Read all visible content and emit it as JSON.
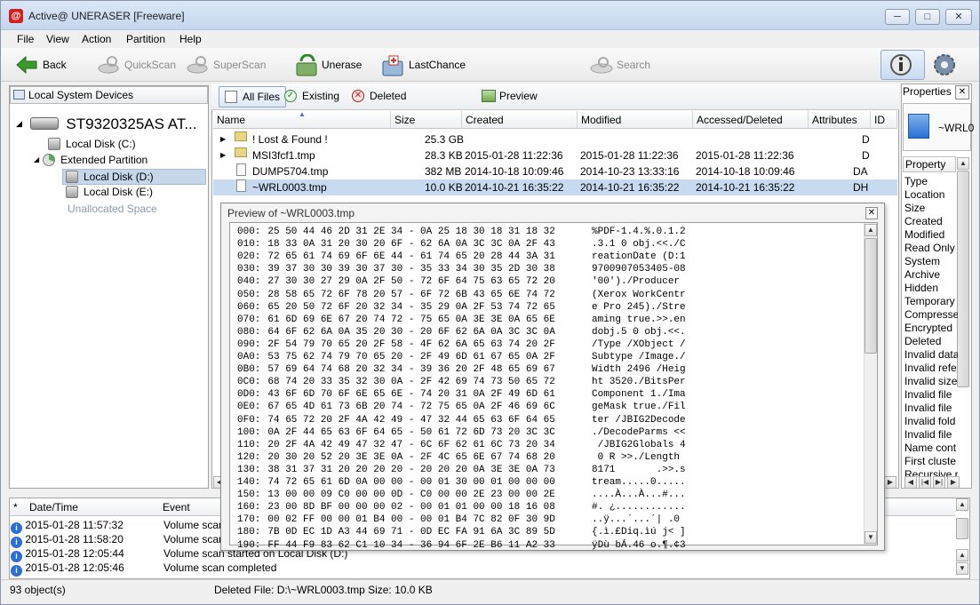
{
  "window": {
    "title": "Active@ UNERASER [Freeware]",
    "minimize": "─",
    "maximize": "□",
    "close": "✕"
  },
  "menu": [
    "File",
    "View",
    "Action",
    "Partition",
    "Help"
  ],
  "toolbar": {
    "back": "Back",
    "quickscan": "QuickScan",
    "superscan": "SuperScan",
    "unerase": "Unerase",
    "lastchance": "LastChance",
    "search": "Search"
  },
  "left_panel": {
    "title": "Local System Devices",
    "drive": "ST9320325AS AT...",
    "items": [
      "Local Disk (C:)",
      "Extended Partition",
      "Local Disk (D:)",
      "Local Disk (E:)",
      "Unallocated Space"
    ]
  },
  "file_tabs": {
    "all": "All Files",
    "existing": "Existing",
    "deleted": "Deleted",
    "preview": "Preview"
  },
  "columns": [
    "Name",
    "Size",
    "Created",
    "Modified",
    "Accessed/Deleted",
    "Attributes",
    "ID"
  ],
  "files": [
    {
      "name": "! Lost & Found !",
      "size": "25.3 GB",
      "created": "",
      "modified": "",
      "accessed": "",
      "attrs": "D"
    },
    {
      "name": "MSI3fcf1.tmp",
      "size": "28.3 KB",
      "created": "2015-01-28 11:22:36",
      "modified": "2015-01-28 11:22:36",
      "accessed": "2015-01-28 11:22:36",
      "attrs": "D"
    },
    {
      "name": "DUMP5704.tmp",
      "size": "382 MB",
      "created": "2014-10-18 10:09:46",
      "modified": "2014-10-23 13:33:16",
      "accessed": "2014-10-18 10:09:46",
      "attrs": "DA"
    },
    {
      "name": "~WRL0003.tmp",
      "size": "10.0 KB",
      "created": "2014-10-21 16:35:22",
      "modified": "2014-10-21 16:35:22",
      "accessed": "2014-10-21 16:35:22",
      "attrs": "DH"
    }
  ],
  "properties": {
    "title": "Properties",
    "file_name": "~WRL0",
    "header": "Property",
    "items": [
      "Type",
      "Location",
      "Size",
      "Created",
      "Modified",
      "Read Only",
      "System",
      "Archive",
      "Hidden",
      "Temporary",
      "Compressed",
      "Encrypted",
      "Deleted",
      "Invalid data",
      "Invalid refe",
      "Invalid size",
      "Invalid file",
      "Invalid file",
      "Invalid fold",
      "Invalid file",
      "Name cont",
      "First cluste",
      "Recursive r"
    ]
  },
  "preview": {
    "title": "Preview of ~WRL0003.tmp",
    "close": "✕",
    "rows": [
      {
        "off": "000:",
        "hex": "25 50 44 46 2D 31 2E 34 - 0A 25 18 30 18 31 18 32",
        "ascii": "%PDF-1.4.%.0.1.2"
      },
      {
        "off": "010:",
        "hex": "18 33 0A 31 20 30 20 6F - 62 6A 0A 3C 3C 0A 2F 43",
        "ascii": ".3.1 0 obj.<<./C"
      },
      {
        "off": "020:",
        "hex": "72 65 61 74 69 6F 6E 44 - 61 74 65 20 28 44 3A 31",
        "ascii": "reationDate (D:1"
      },
      {
        "off": "030:",
        "hex": "39 37 30 30 39 30 37 30 - 35 33 34 30 35 2D 30 38",
        "ascii": "9700907053405-08"
      },
      {
        "off": "040:",
        "hex": "27 30 30 27 29 0A 2F 50 - 72 6F 64 75 63 65 72 20",
        "ascii": "'00')./Producer "
      },
      {
        "off": "050:",
        "hex": "28 58 65 72 6F 78 20 57 - 6F 72 6B 43 65 6E 74 72",
        "ascii": "(Xerox WorkCentr"
      },
      {
        "off": "060:",
        "hex": "65 20 50 72 6F 20 32 34 - 35 29 0A 2F 53 74 72 65",
        "ascii": "e Pro 245)./Stre"
      },
      {
        "off": "070:",
        "hex": "61 6D 69 6E 67 20 74 72 - 75 65 0A 3E 3E 0A 65 6E",
        "ascii": "aming true.>>.en"
      },
      {
        "off": "080:",
        "hex": "64 6F 62 6A 0A 35 20 30 - 20 6F 62 6A 0A 3C 3C 0A",
        "ascii": "dobj.5 0 obj.<<."
      },
      {
        "off": "090:",
        "hex": "2F 54 79 70 65 20 2F 58 - 4F 62 6A 65 63 74 20 2F",
        "ascii": "/Type /XObject /"
      },
      {
        "off": "0A0:",
        "hex": "53 75 62 74 79 70 65 20 - 2F 49 6D 61 67 65 0A 2F",
        "ascii": "Subtype /Image./"
      },
      {
        "off": "0B0:",
        "hex": "57 69 64 74 68 20 32 34 - 39 36 20 2F 48 65 69 67",
        "ascii": "Width 2496 /Heig"
      },
      {
        "off": "0C0:",
        "hex": "68 74 20 33 35 32 30 0A - 2F 42 69 74 73 50 65 72",
        "ascii": "ht 3520./BitsPer"
      },
      {
        "off": "0D0:",
        "hex": "43 6F 6D 70 6F 6E 65 6E - 74 20 31 0A 2F 49 6D 61",
        "ascii": "Component 1./Ima"
      },
      {
        "off": "0E0:",
        "hex": "67 65 4D 61 73 6B 20 74 - 72 75 65 0A 2F 46 69 6C",
        "ascii": "geMask true./Fil"
      },
      {
        "off": "0F0:",
        "hex": "74 65 72 20 2F 4A 42 49 - 47 32 44 65 63 6F 64 65",
        "ascii": "ter /JBIG2Decode"
      },
      {
        "off": "100:",
        "hex": "0A 2F 44 65 63 6F 64 65 - 50 61 72 6D 73 20 3C 3C",
        "ascii": "./DecodeParms <<"
      },
      {
        "off": "110:",
        "hex": "20 2F 4A 42 49 47 32 47 - 6C 6F 62 61 6C 73 20 34",
        "ascii": " /JBIG2Globals 4"
      },
      {
        "off": "120:",
        "hex": "20 30 20 52 20 3E 3E 0A - 2F 4C 65 6E 67 74 68 20",
        "ascii": " 0 R >>./Length "
      },
      {
        "off": "130:",
        "hex": "38 31 37 31 20 20 20 20 - 20 20 20 0A 3E 3E 0A 73",
        "ascii": "8171       .>>.s"
      },
      {
        "off": "140:",
        "hex": "74 72 65 61 6D 0A 00 00 - 00 01 30 00 01 00 00 00",
        "ascii": "tream.....0....."
      },
      {
        "off": "150:",
        "hex": "13 00 00 09 C0 00 00 0D - C0 00 00 2E 23 00 00 2E",
        "ascii": "....À...À...#..."
      },
      {
        "off": "160:",
        "hex": "23 00 8D BF 00 00 00 02 - 00 01 01 00 00 18 16 08",
        "ascii": "#. ¿............"
      },
      {
        "off": "170:",
        "hex": "00 02 FF 00 00 01 B4 00 - 00 01 B4 7C 82 0F 30 9D",
        "ascii": "..ÿ...´...´| .0 "
      },
      {
        "off": "180:",
        "hex": "7B 0D EC 1D A3 44 69 71 - 0D EC FA 91 6A 3C 89 5D",
        "ascii": "{.ì.£Diq.ìú j< ]"
      },
      {
        "off": "190:",
        "hex": "FF 44 F9 83 62 C1 10 34 - 36 94 6F 2E B6 11 A2 33",
        "ascii": "ÿDù bÁ.46 o.¶.¢3"
      }
    ]
  },
  "log": {
    "col_star": "*",
    "col_date": "Date/Time",
    "col_event": "Event",
    "rows": [
      {
        "date": "2015-01-28 11:57:32",
        "event": "Volume scan"
      },
      {
        "date": "2015-01-28 11:58:20",
        "event": "Volume scan"
      },
      {
        "date": "2015-01-28 12:05:44",
        "event": "Volume scan started on Local Disk (D:)"
      },
      {
        "date": "2015-01-28 12:05:46",
        "event": "Volume scan completed"
      }
    ]
  },
  "status": {
    "objects": "93 object(s)",
    "detail": "Deleted File: D:\\~WRL0003.tmp Size: 10.0 KB"
  },
  "colors": {
    "accent": "#2a6fd6",
    "selection": "#c8daf0",
    "brand_red": "#d02020"
  }
}
